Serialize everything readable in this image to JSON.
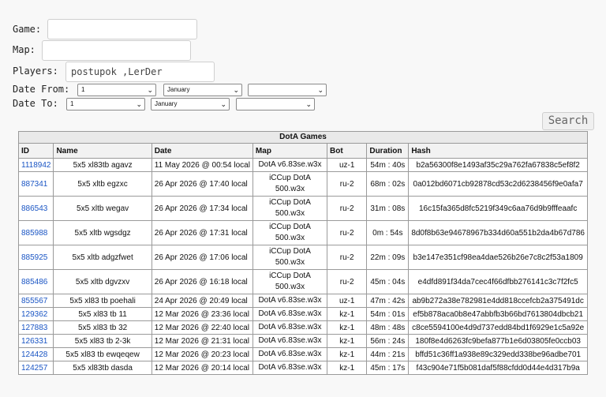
{
  "filters": {
    "game_label": "Game:",
    "game_value": "",
    "map_label": "Map:",
    "map_value": "",
    "players_label": "Players:",
    "players_value": "postupok ,LerDer",
    "date_from_label": "Date From:",
    "date_to_label": "Date To:",
    "date_from": {
      "day": "1",
      "month": "January",
      "year": ""
    },
    "date_to": {
      "day": "1",
      "month": "January",
      "year": ""
    },
    "search_label": "Search"
  },
  "table": {
    "caption": "DotA Games",
    "headers": [
      "ID",
      "Name",
      "Date",
      "Map",
      "Bot",
      "Duration",
      "Hash"
    ],
    "rows": [
      {
        "id": "1118942",
        "name": "5x5 xl83tb agavz",
        "date": "11 May 2026 @ 00:54 local",
        "map": "DotA v6.83se.w3x",
        "bot": "uz-1",
        "duration": "54m : 40s",
        "hash": "b2a56300f8e1493af35c29a762fa67838c5ef8f2"
      },
      {
        "id": "887341",
        "name": "5x5 xltb egzxc",
        "date": "26 Apr 2026 @ 17:40 local",
        "map": "iCCup DotA 500.w3x",
        "bot": "ru-2",
        "duration": "68m : 02s",
        "hash": "0a012bd6071cb92878cd53c2d6238456f9e0afa7"
      },
      {
        "id": "886543",
        "name": "5x5 xltb wegav",
        "date": "26 Apr 2026 @ 17:34 local",
        "map": "iCCup DotA 500.w3x",
        "bot": "ru-2",
        "duration": "31m : 08s",
        "hash": "16c15fa365d8fc5219f349c6aa76d9b9fffeaafc"
      },
      {
        "id": "885988",
        "name": "5x5 xltb wgsdgz",
        "date": "26 Apr 2026 @ 17:31 local",
        "map": "iCCup DotA 500.w3x",
        "bot": "ru-2",
        "duration": "0m : 54s",
        "hash": "8d0f8b63e94678967b334d60a551b2da4b67d786"
      },
      {
        "id": "885925",
        "name": "5x5 xltb adgzfwet",
        "date": "26 Apr 2026 @ 17:06 local",
        "map": "iCCup DotA 500.w3x",
        "bot": "ru-2",
        "duration": "22m : 09s",
        "hash": "b3e147e351cf98ea4dae526b26e7c8c2f53a1809"
      },
      {
        "id": "885486",
        "name": "5x5 xltb dgvzxv",
        "date": "26 Apr 2026 @ 16:18 local",
        "map": "iCCup DotA 500.w3x",
        "bot": "ru-2",
        "duration": "45m : 04s",
        "hash": "e4dfd891f34da7cec4f66dfbb276141c3c7f2fc5"
      },
      {
        "id": "855567",
        "name": "5x5 xl83 tb poehali",
        "date": "24 Apr 2026 @ 20:49 local",
        "map": "DotA v6.83se.w3x",
        "bot": "uz-1",
        "duration": "47m : 42s",
        "hash": "ab9b272a38e782981e4dd818ccefcb2a375491dc"
      },
      {
        "id": "129362",
        "name": "5x5 xl83 tb 11",
        "date": "12 Mar 2026 @ 23:36 local",
        "map": "DotA v6.83se.w3x",
        "bot": "kz-1",
        "duration": "54m : 01s",
        "hash": "ef5b878aca0b8e47abbfb3b66bd7613804dbcb21"
      },
      {
        "id": "127883",
        "name": "5x5 xl83 tb 32",
        "date": "12 Mar 2026 @ 22:40 local",
        "map": "DotA v6.83se.w3x",
        "bot": "kz-1",
        "duration": "48m : 48s",
        "hash": "c8ce5594100e4d9d737edd84bd1f6929e1c5a92e"
      },
      {
        "id": "126331",
        "name": "5x5 xl83 tb 2-3k",
        "date": "12 Mar 2026 @ 21:31 local",
        "map": "DotA v6.83se.w3x",
        "bot": "kz-1",
        "duration": "56m : 24s",
        "hash": "180f8e4d6263fc9befa877b1e6d03805fe0ccb03"
      },
      {
        "id": "124428",
        "name": "5x5 xl83 tb ewqeqew",
        "date": "12 Mar 2026 @ 20:23 local",
        "map": "DotA v6.83se.w3x",
        "bot": "kz-1",
        "duration": "44m : 21s",
        "hash": "bffd51c36ff1a938e89c329edd338be96adbe701"
      },
      {
        "id": "124257",
        "name": "5x5 xl83tb dasda",
        "date": "12 Mar 2026 @ 20:14 local",
        "map": "DotA v6.83se.w3x",
        "bot": "kz-1",
        "duration": "45m : 17s",
        "hash": "f43c904e71f5b081daf5f88cfdd0d44e4d317b9a"
      }
    ]
  }
}
